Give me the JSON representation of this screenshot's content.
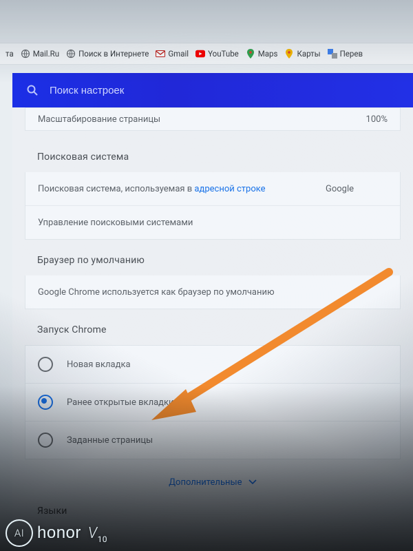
{
  "bookmarks": {
    "b0": "та",
    "b1": "Mail.Ru",
    "b2": "Поиск в Интернете",
    "b3": "Gmail",
    "b4": "YouTube",
    "b5": "Maps",
    "b6": "Карты",
    "b7": "Перев"
  },
  "search": {
    "placeholder": "Поиск настроек"
  },
  "zoom": {
    "label": "Масштабирование страницы",
    "value": "100%"
  },
  "engine": {
    "heading": "Поисковая система",
    "row1a": "Поисковая система, используемая в ",
    "row1link": "адресной строке",
    "row1val": "Google",
    "row2": "Управление поисковыми системами"
  },
  "defaultb": {
    "heading": "Браузер по умолчанию",
    "text": "Google Chrome используется как браузер по умолчанию"
  },
  "startup": {
    "heading": "Запуск Chrome",
    "opt0": "Новая вкладка",
    "opt1": "Ранее открытые вкладки",
    "opt2": "Заданные страницы"
  },
  "expand": "Дополнительные",
  "langs": "Языки",
  "watermark": {
    "brand": "honor",
    "model": "V",
    "num": "10"
  }
}
